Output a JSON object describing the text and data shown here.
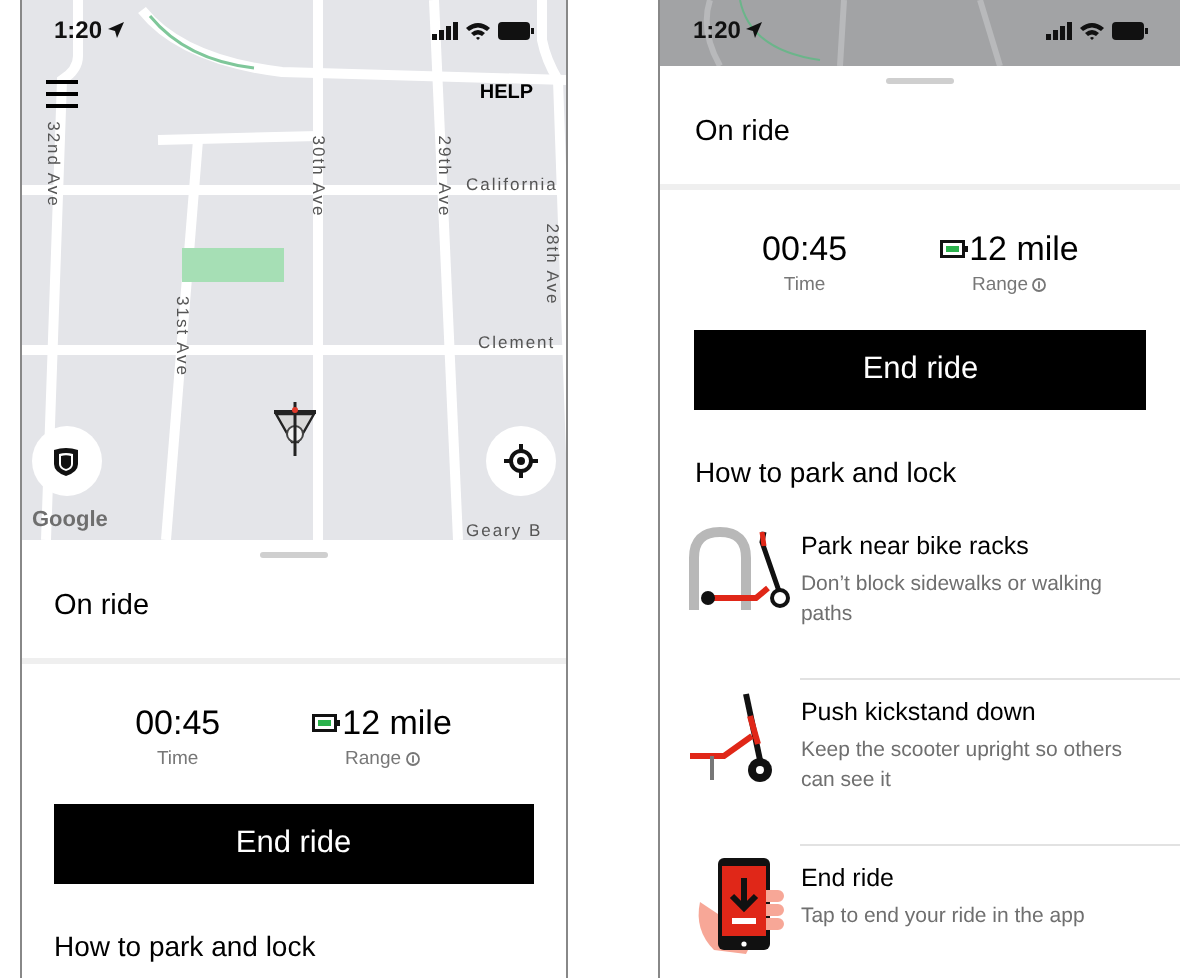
{
  "screens": [
    {
      "kind": "map_view",
      "status_bar": {
        "time": "1:20"
      },
      "map": {
        "help": "HELP",
        "attribution": "Google",
        "labels": [
          {
            "text": "32nd Ave",
            "kind": "vertical"
          },
          {
            "text": "30th Ave",
            "kind": "vertical"
          },
          {
            "text": "29th Ave",
            "kind": "vertical"
          },
          {
            "text": "California",
            "kind": "horizontal"
          },
          {
            "text": "28th Ave",
            "kind": "vertical"
          },
          {
            "text": "31st Ave",
            "kind": "vertical"
          },
          {
            "text": "Clement",
            "kind": "horizontal"
          },
          {
            "text": "Geary B",
            "kind": "horizontal"
          }
        ]
      },
      "sheet": {
        "title": "On ride",
        "stats": [
          {
            "kind": "time",
            "value": "00:45",
            "label": "Time"
          },
          {
            "kind": "range",
            "value": "12 mile",
            "label": "Range"
          }
        ],
        "button": "End ride",
        "section_title": "How to park and lock"
      }
    },
    {
      "kind": "expanded",
      "status_bar": {
        "time": "1:20"
      },
      "sheet": {
        "title": "On ride",
        "stats": [
          {
            "kind": "time",
            "value": "00:45",
            "label": "Time"
          },
          {
            "kind": "range",
            "value": "12 mile",
            "label": "Range"
          }
        ],
        "button": "End ride",
        "section_title": "How to park and lock",
        "steps": [
          {
            "kind": "rack",
            "title": "Park near bike racks",
            "description": "Don’t block sidewalks or walking paths"
          },
          {
            "kind": "kickstand",
            "title": "Push kickstand down",
            "description": "Keep the scooter upright so others can see it"
          },
          {
            "kind": "phone",
            "title": "End ride",
            "description": "Tap to end your ride in the app"
          }
        ]
      }
    }
  ]
}
